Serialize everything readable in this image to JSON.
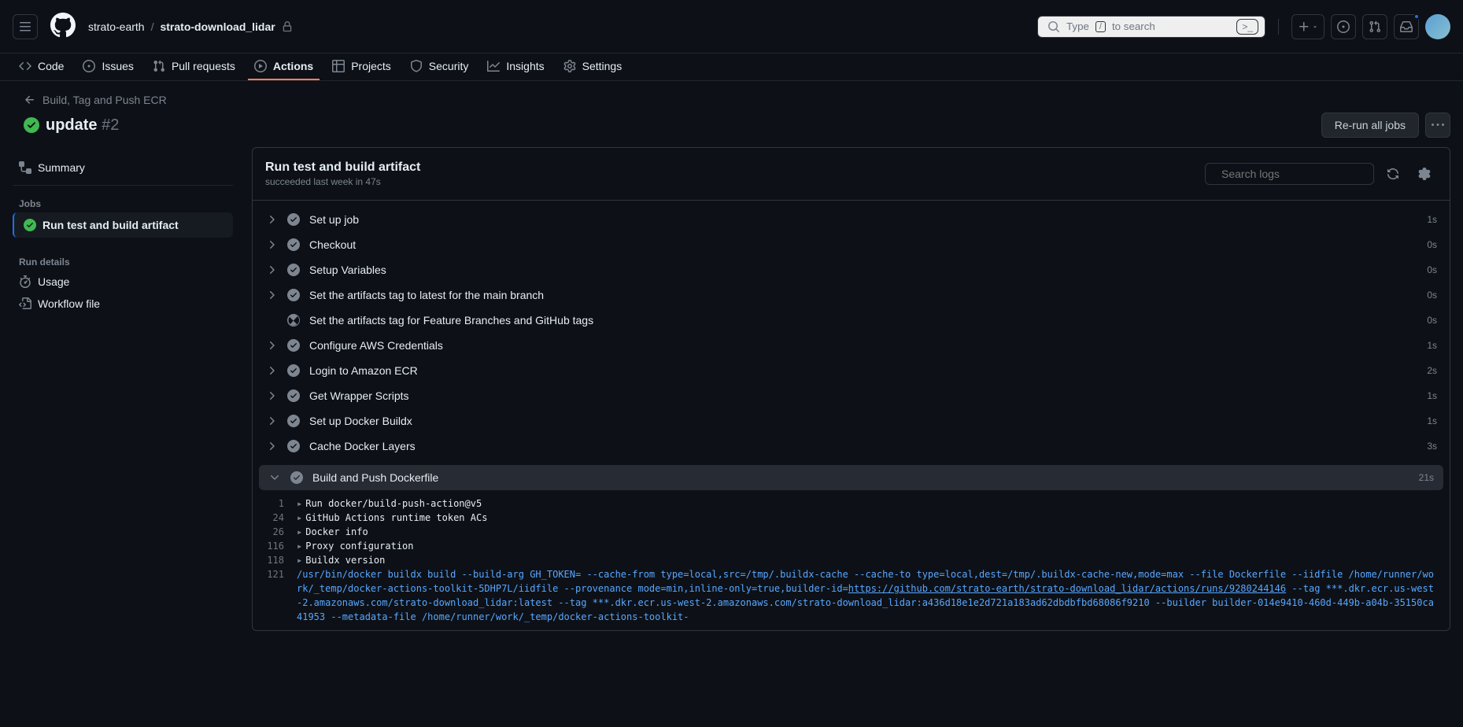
{
  "header": {
    "owner": "strato-earth",
    "repo": "strato-download_lidar",
    "search_placeholder": "Type",
    "search_suffix": "to search",
    "search_key": "/"
  },
  "nav": {
    "code": "Code",
    "issues": "Issues",
    "pull_requests": "Pull requests",
    "actions": "Actions",
    "projects": "Projects",
    "security": "Security",
    "insights": "Insights",
    "settings": "Settings"
  },
  "workflow": {
    "back_label": "Build, Tag and Push ECR",
    "title": "update",
    "run_number": "#2",
    "rerun_label": "Re-run all jobs"
  },
  "sidebar": {
    "summary": "Summary",
    "jobs_heading": "Jobs",
    "job_name": "Run test and build artifact",
    "run_details_heading": "Run details",
    "usage": "Usage",
    "workflow_file": "Workflow file"
  },
  "job": {
    "title": "Run test and build artifact",
    "subtitle": "succeeded last week in 47s",
    "search_placeholder": "Search logs"
  },
  "steps": [
    {
      "name": "Set up job",
      "duration": "1s",
      "status": "success"
    },
    {
      "name": "Checkout",
      "duration": "0s",
      "status": "success"
    },
    {
      "name": "Setup Variables",
      "duration": "0s",
      "status": "success"
    },
    {
      "name": "Set the artifacts tag to latest for the main branch",
      "duration": "0s",
      "status": "success"
    },
    {
      "name": "Set the artifacts tag for Feature Branches and GitHub tags",
      "duration": "0s",
      "status": "skip"
    },
    {
      "name": "Configure AWS Credentials",
      "duration": "1s",
      "status": "success"
    },
    {
      "name": "Login to Amazon ECR",
      "duration": "2s",
      "status": "success"
    },
    {
      "name": "Get Wrapper Scripts",
      "duration": "1s",
      "status": "success"
    },
    {
      "name": "Set up Docker Buildx",
      "duration": "1s",
      "status": "success"
    },
    {
      "name": "Cache Docker Layers",
      "duration": "3s",
      "status": "success"
    }
  ],
  "expanded_step": {
    "name": "Build and Push Dockerfile",
    "duration": "21s"
  },
  "logs": [
    {
      "num": "1",
      "text": "Run docker/build-push-action@v5",
      "fold": true
    },
    {
      "num": "24",
      "text": "GitHub Actions runtime token ACs",
      "fold": true
    },
    {
      "num": "26",
      "text": "Docker info",
      "fold": true
    },
    {
      "num": "116",
      "text": "Proxy configuration",
      "fold": true
    },
    {
      "num": "118",
      "text": "Buildx version",
      "fold": true
    }
  ],
  "cmd_log": {
    "num": "121",
    "prefix": "/usr/bin/docker buildx build --build-arg GH_TOKEN= --cache-from type=local,src=/tmp/.buildx-cache --cache-to type=local,dest=/tmp/.buildx-cache-new,mode=max --file Dockerfile --iidfile /home/runner/work/_temp/docker-actions-toolkit-5DHP7L/iidfile --provenance mode=min,inline-only=true,builder-id=",
    "link": "https://github.com/strato-earth/strato-download_lidar/actions/runs/9280244146",
    "suffix": " --tag ***.dkr.ecr.us-west-2.amazonaws.com/strato-download_lidar:latest --tag ***.dkr.ecr.us-west-2.amazonaws.com/strato-download_lidar:a436d18e1e2d721a183ad62dbdbfbd68086f9210 --builder builder-014e9410-460d-449b-a04b-35150ca41953 --metadata-file /home/runner/work/_temp/docker-actions-toolkit-"
  }
}
